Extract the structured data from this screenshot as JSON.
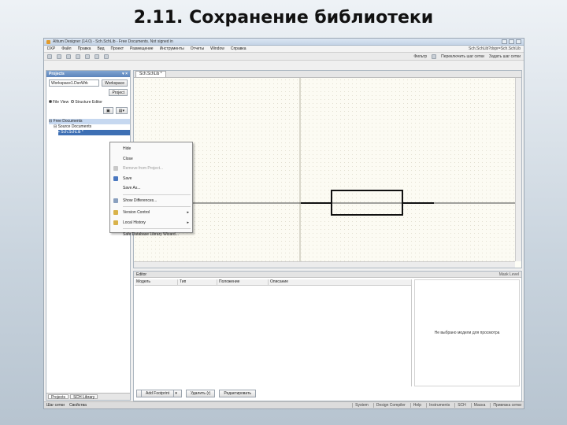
{
  "slide": {
    "title": "2.11. Сохранение библиотеки"
  },
  "window": {
    "title": "Altium Designer (14.0) - Sch.SchLib - Free Documents. Not signed in"
  },
  "menubar": {
    "items": [
      "DXP",
      "Файл",
      "Правка",
      "Вид",
      "Проект",
      "Размещение",
      "Инструменты",
      "Отчеты",
      "Window",
      "Справка"
    ],
    "path": "Sch.SchLib?dxpr=Sch.SchLib"
  },
  "toolbar": {
    "filter_label": "Фильтр",
    "panel_toggle": "Переключить шаг сетки",
    "grid_step": "Задать шаг сетки"
  },
  "projects_panel": {
    "header": "Projects",
    "workspace_combo": "Workspace1.DsnWrk",
    "workspace_btn": "Workspace",
    "project_btn": "Project",
    "file_view": "File View",
    "structure_editor": "Structure Editor",
    "tree": [
      "Free Documents",
      "Source Documents",
      "Sch.SchLib *"
    ],
    "tabs": [
      "Projects",
      "SCH Library"
    ]
  },
  "editor": {
    "tab_label": "Sch.SchLib *"
  },
  "context_menu": {
    "items": [
      {
        "label": "Hide"
      },
      {
        "label": "Close"
      },
      {
        "label": "Remove from Project..."
      },
      {
        "label": "Save"
      },
      {
        "label": "Save As..."
      },
      {
        "label": "Show Differences..."
      },
      {
        "label": "Version Control"
      },
      {
        "label": "Local History"
      },
      {
        "label": "Safe Database Library Wizard..."
      }
    ]
  },
  "bottom_panel": {
    "header": "Editor",
    "header_right": "Mask Level",
    "columns": [
      "Модель",
      "Тип",
      "Положение",
      "Описание"
    ],
    "preview_message": "Не выбрано модели для просмотра",
    "buttons": [
      "Add Footprint",
      "Удалить (r)",
      "Редактировать"
    ]
  },
  "statusbar": {
    "left": [
      "Шаг сетки",
      "Свойства"
    ],
    "right": [
      "System",
      "Design Compiler",
      "Help",
      "Instruments",
      "SCH",
      "Маска",
      "Привязка сетки"
    ]
  }
}
